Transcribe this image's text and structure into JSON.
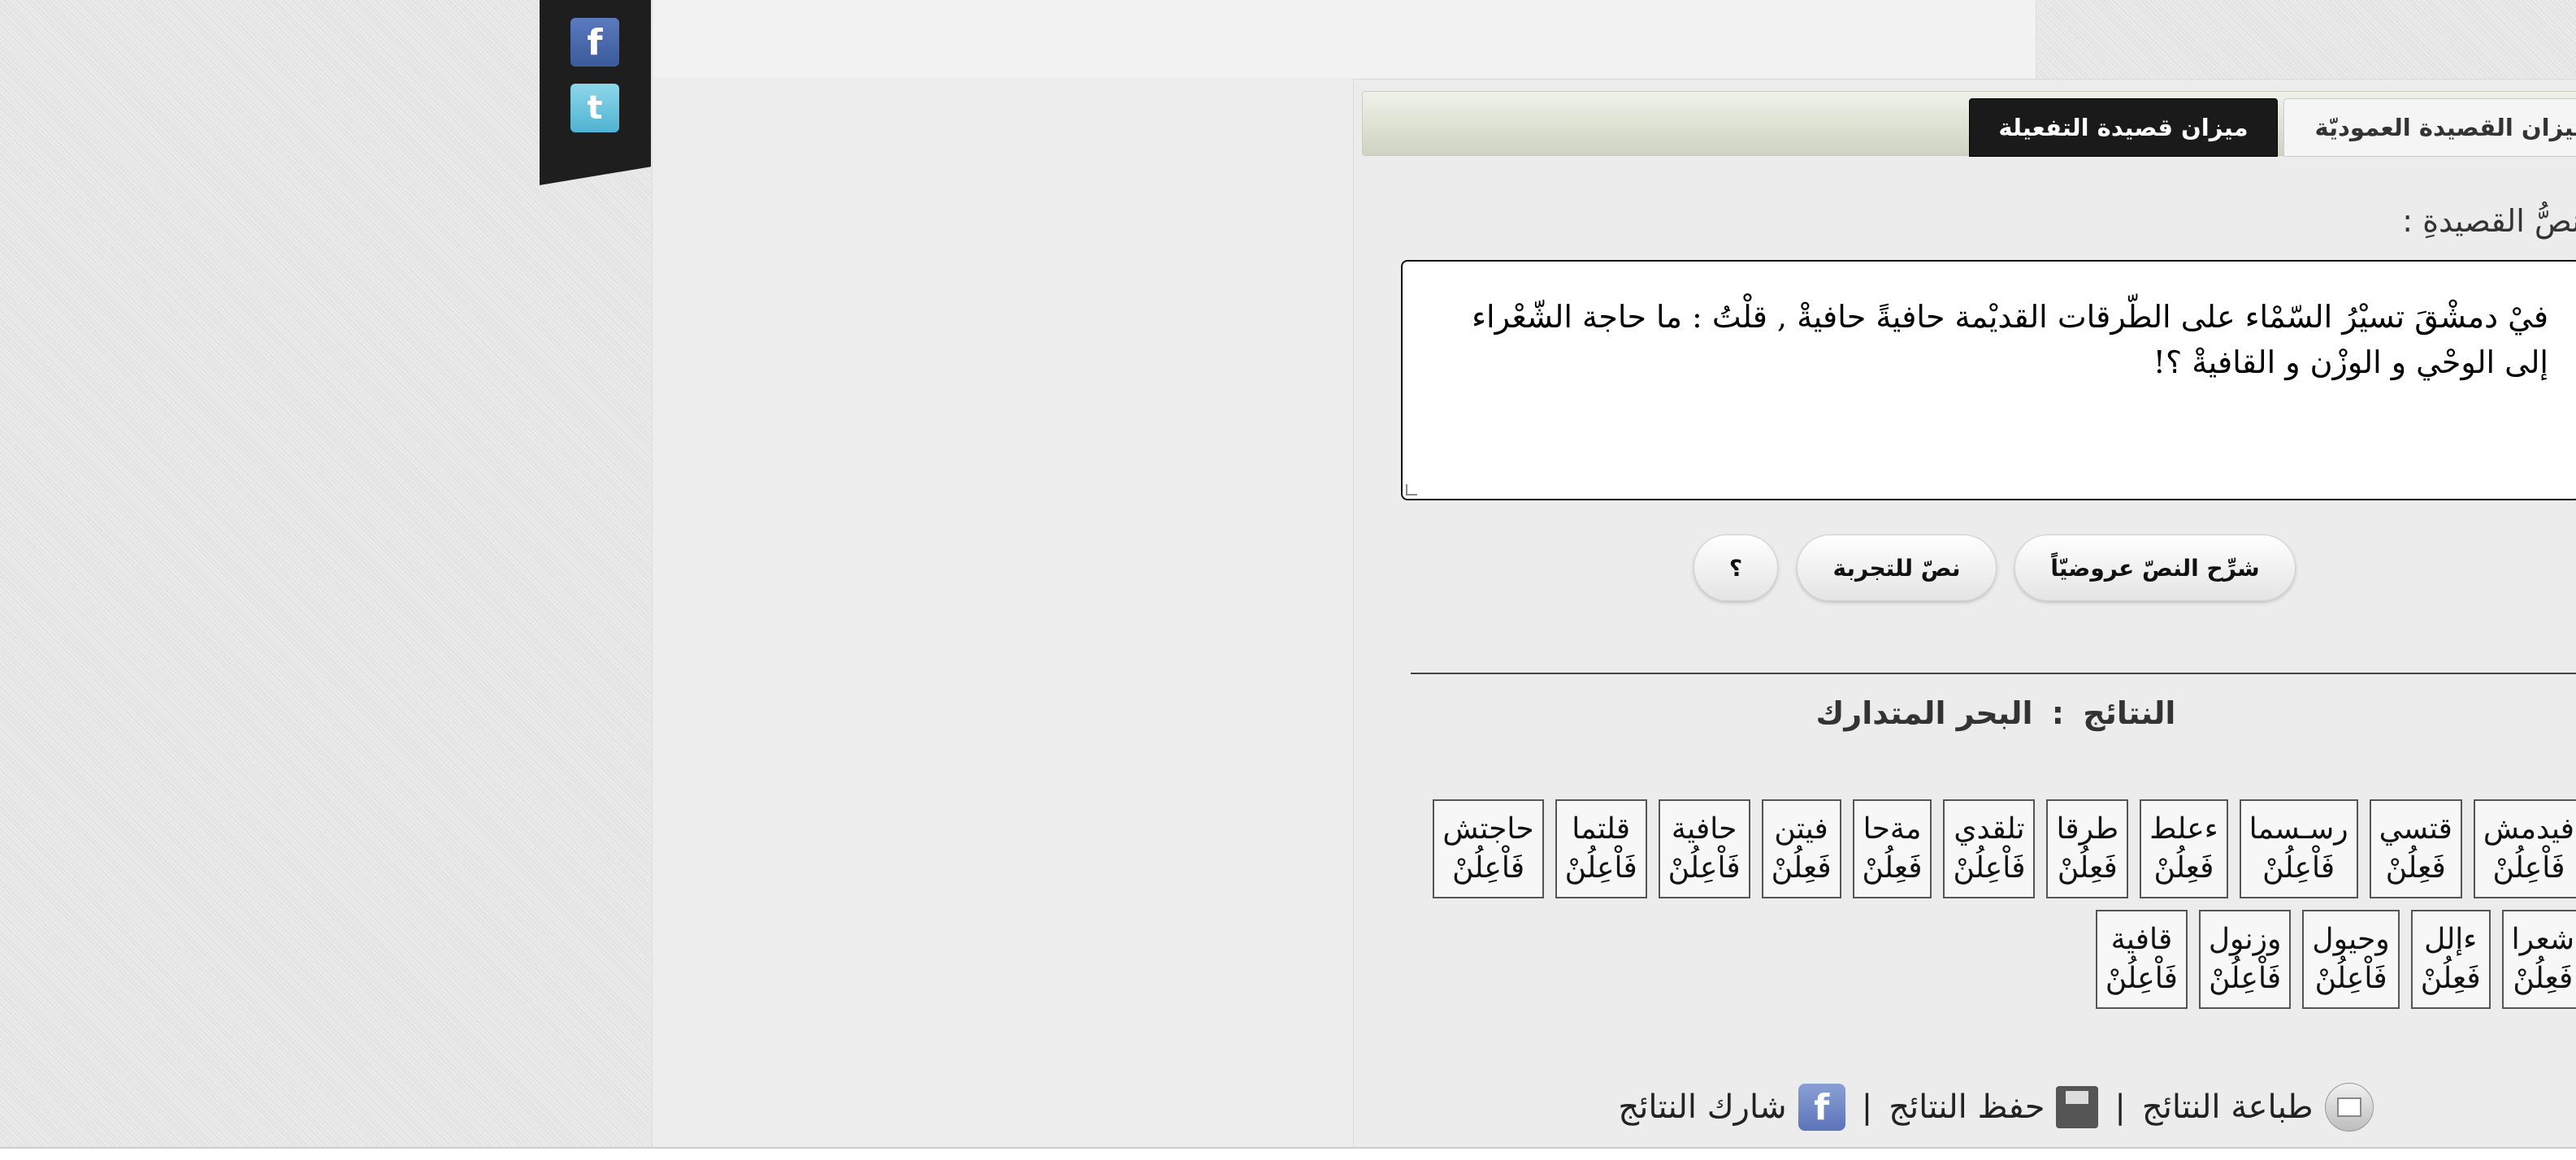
{
  "tabs": [
    {
      "label": "ميزان القصيدة العموديّة",
      "active": false
    },
    {
      "label": "ميزان قصيدة التفعيلة",
      "active": true
    }
  ],
  "social": {
    "facebook_icon": "facebook-icon",
    "twitter_icon": "twitter-icon"
  },
  "poem_label": "نصُّ القصيدةِ :",
  "poem_text": "فيْ دمشْقَ تسيْرُ السّمْاء على الطّرقات القديْمة حافيةً حافيةْ , قلْتُ : ما حاجة الشّعْراء إلى الوحْي و الوزْن و القافيةْ ؟!",
  "buttons": {
    "analyze": "شرِّح النصّ عروضيّاً",
    "sample": "نصّ للتجربة",
    "help": "؟"
  },
  "results": {
    "heading": "النتائج",
    "separator": ":",
    "meter": "البحر المتدارك",
    "cells": [
      {
        "word": "فيدمش",
        "foot": "فَاْعِلُنْ"
      },
      {
        "word": "قتسي",
        "foot": "فَعِلُنْ"
      },
      {
        "word": "رسـسما",
        "foot": "فَاْعِلُنْ"
      },
      {
        "word": "ءعلط",
        "foot": "فَعِلُنْ"
      },
      {
        "word": "طرقا",
        "foot": "فَعِلُنْ"
      },
      {
        "word": "تلقدي",
        "foot": "فَاْعِلُنْ"
      },
      {
        "word": "مةحا",
        "foot": "فَعِلُنْ"
      },
      {
        "word": "فيتن",
        "foot": "فَعِلُنْ"
      },
      {
        "word": "حافية",
        "foot": "فَاْعِلُنْ"
      },
      {
        "word": "قلتما",
        "foot": "فَاْعِلُنْ"
      },
      {
        "word": "حاجتش",
        "foot": "فَاْعِلُنْ"
      },
      {
        "word": "شعرا",
        "foot": "فَعِلُنْ"
      },
      {
        "word": "ءإلل",
        "foot": "فَعِلُنْ"
      },
      {
        "word": "وحيول",
        "foot": "فَاْعِلُنْ"
      },
      {
        "word": "وزنول",
        "foot": "فَاْعِلُنْ"
      },
      {
        "word": "قافية",
        "foot": "فَاْعِلُنْ"
      }
    ]
  },
  "footer": {
    "print_label": "طباعة النتائج",
    "save_label": "حفظ النتائج",
    "share_label": "شارك النتائج",
    "separator": "|",
    "print_icon": "print-icon",
    "save_icon": "save-icon",
    "share_icon": "facebook-share-icon"
  }
}
